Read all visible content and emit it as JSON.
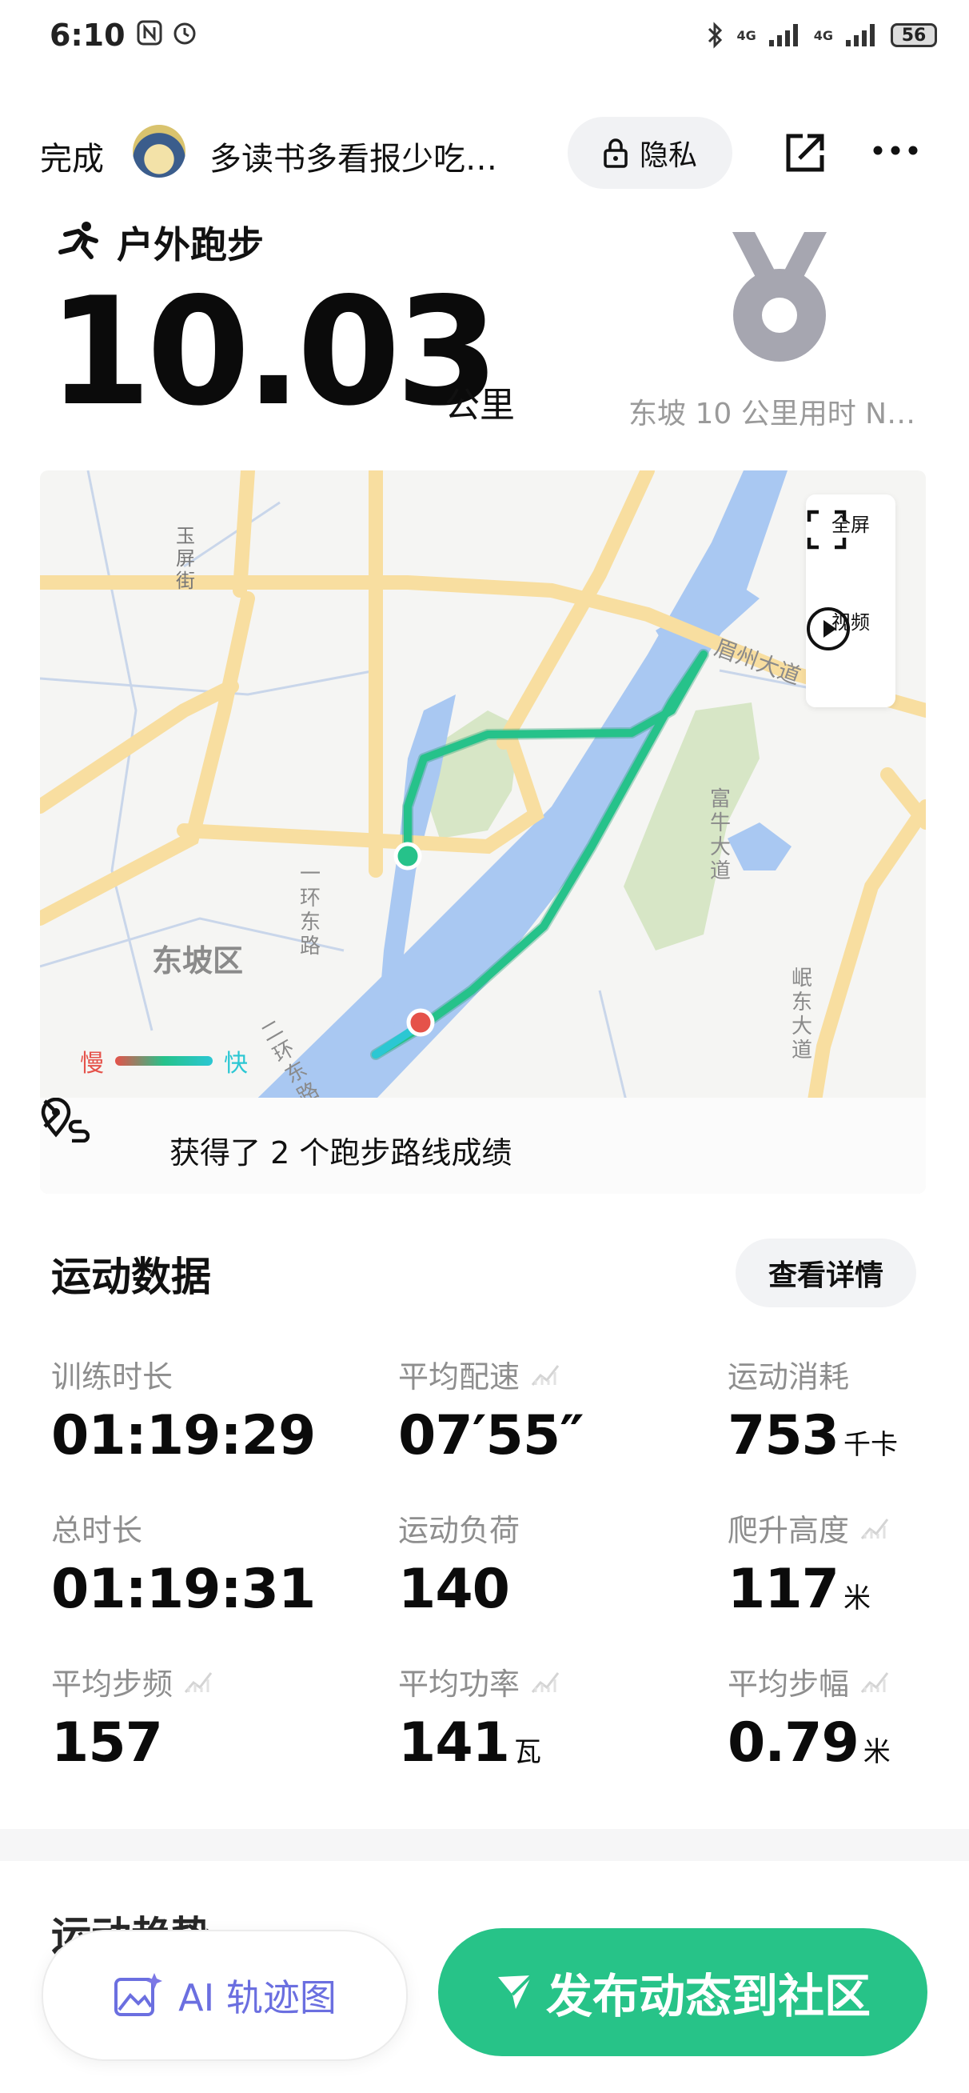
{
  "status_bar": {
    "time": "6:10",
    "battery": "56",
    "network_left": "4G",
    "network_right": "4G"
  },
  "header": {
    "done_label": "完成",
    "username": "多读书多看报少吃…",
    "privacy_label": "隐私"
  },
  "workout": {
    "sport_type": "户外跑步",
    "distance": "10.03",
    "distance_unit": "公里",
    "medal_label": "东坡 10 公里用时 N…"
  },
  "map": {
    "controls": {
      "fullscreen_label": "全屏",
      "video_label": "视频"
    },
    "legend": {
      "slow": "慢",
      "fast": "快"
    },
    "labels": {
      "street1": "玉屏街",
      "district": "东坡区",
      "road_ring1": "一环东路",
      "road_ring2": "二环东路",
      "road_meizhou": "眉州大道",
      "road_funiu": "富牛大道",
      "road_mindong": "岷东大道"
    },
    "route_banner": "获得了 2 个跑步路线成绩"
  },
  "stats": {
    "title": "运动数据",
    "details_label": "查看详情",
    "items": [
      {
        "label": "训练时长",
        "value": "01:19:29",
        "unit": ""
      },
      {
        "label": "平均配速",
        "value": "07′55″",
        "unit": ""
      },
      {
        "label": "运动消耗",
        "value": "753",
        "unit": "千卡"
      },
      {
        "label": "总时长",
        "value": "01:19:31",
        "unit": ""
      },
      {
        "label": "运动负荷",
        "value": "140",
        "unit": ""
      },
      {
        "label": "爬升高度",
        "value": "117",
        "unit": "米"
      },
      {
        "label": "平均步频",
        "value": "157",
        "unit": ""
      },
      {
        "label": "平均功率",
        "value": "141",
        "unit": "瓦"
      },
      {
        "label": "平均步幅",
        "value": "0.79",
        "unit": "米"
      }
    ]
  },
  "next_section": {
    "title": "运动趋势"
  },
  "actions": {
    "ai_label": "AI 轨迹图",
    "publish_label": "发布动态到社区"
  },
  "colors": {
    "accent_green": "#27c388",
    "route_green": "#26c28a",
    "route_cyan": "#2bc7d3",
    "start_red": "#e5524a",
    "river": "#a9c8f2",
    "road": "#f8dea0",
    "park": "#d7e6c6"
  }
}
